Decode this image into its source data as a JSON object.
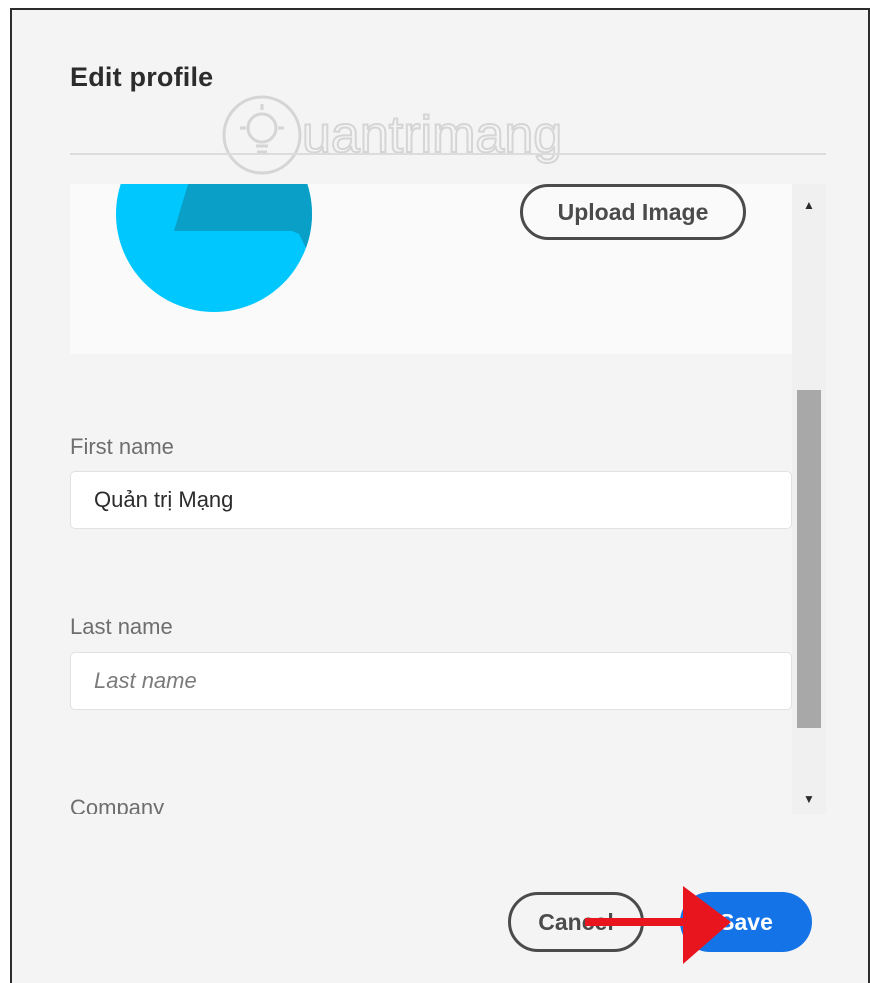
{
  "dialog": {
    "title": "Edit profile",
    "watermark": "uantrimang",
    "upload_label": "Upload Image",
    "fields": {
      "first_name": {
        "label": "First name",
        "value": "Quản trị Mạng"
      },
      "last_name": {
        "label": "Last name",
        "placeholder": "Last name",
        "value": ""
      },
      "company": {
        "label": "Company"
      }
    },
    "buttons": {
      "cancel": "Cancel",
      "save": "Save"
    }
  },
  "colors": {
    "accent": "#1473e6",
    "avatar": "#00c8ff",
    "avatar_shape": "#0a9fc7",
    "annotation_arrow": "#e8141e"
  }
}
